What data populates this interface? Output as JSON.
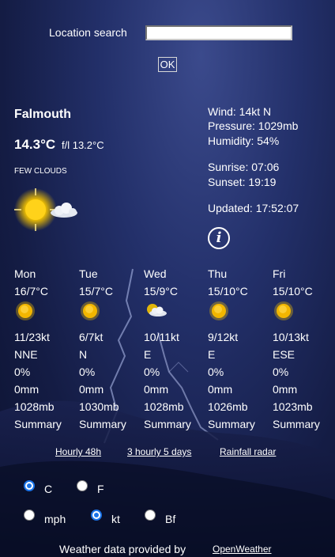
{
  "search": {
    "label": "Location search",
    "value": "",
    "button": "OK"
  },
  "current": {
    "location": "Falmouth",
    "temp": "14.3°C",
    "feels_like": "f/l 13.2°C",
    "condition": "FEW CLOUDS",
    "icon": "sun-with-cloud-icon"
  },
  "details": {
    "wind": "Wind: 14kt N",
    "pressure": "Pressure: 1029mb",
    "humidity": "Humidity: 54%",
    "sunrise": "Sunrise: 07:06",
    "sunset": "Sunset: 19:19",
    "updated": "Updated: 17:52:07",
    "info_icon": "i"
  },
  "forecast": [
    {
      "day": "Mon",
      "temps": "16/7°C",
      "icon": "sun-icon",
      "wind": "11/23kt",
      "dir": "NNE",
      "precip_prob": "0%",
      "rain": "0mm",
      "pressure": "1028mb",
      "summary": "Summary"
    },
    {
      "day": "Tue",
      "temps": "15/7°C",
      "icon": "sun-icon",
      "wind": "6/7kt",
      "dir": "N",
      "precip_prob": "0%",
      "rain": "0mm",
      "pressure": "1030mb",
      "summary": "Summary"
    },
    {
      "day": "Wed",
      "temps": "15/9°C",
      "icon": "sun-cloud-icon",
      "wind": "10/11kt",
      "dir": "E",
      "precip_prob": "0%",
      "rain": "0mm",
      "pressure": "1028mb",
      "summary": "Summary"
    },
    {
      "day": "Thu",
      "temps": "15/10°C",
      "icon": "sun-icon",
      "wind": "9/12kt",
      "dir": "E",
      "precip_prob": "0%",
      "rain": "0mm",
      "pressure": "1026mb",
      "summary": "Summary"
    },
    {
      "day": "Fri",
      "temps": "15/10°C",
      "icon": "sun-icon",
      "wind": "10/13kt",
      "dir": "ESE",
      "precip_prob": "0%",
      "rain": "0mm",
      "pressure": "1023mb",
      "summary": "Summary"
    }
  ],
  "links": {
    "hourly": "Hourly 48h",
    "three_hourly": "3 hourly 5 days",
    "radar": "Rainfall radar"
  },
  "units": {
    "temp_c": "C",
    "temp_f": "F",
    "temp_selected": "C",
    "speed_mph": "mph",
    "speed_kt": "kt",
    "speed_bf": "Bf",
    "speed_selected": "kt"
  },
  "footer": {
    "text": "Weather data provided by",
    "link": "OpenWeather"
  },
  "colors": {
    "sun": "#f5b800",
    "background": "#1c2658",
    "radio_accent": "#1a73e8"
  }
}
